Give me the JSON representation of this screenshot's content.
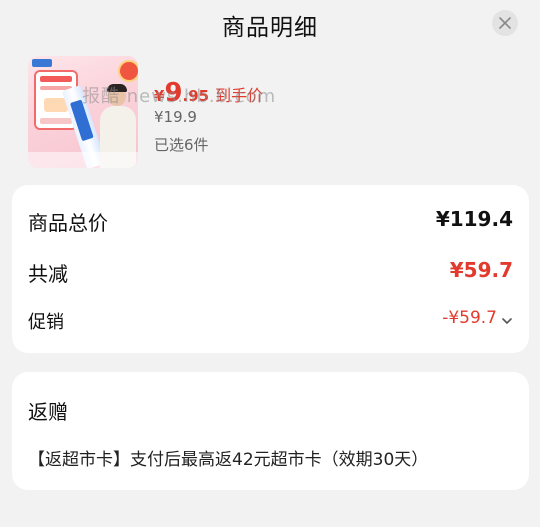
{
  "header": {
    "title": "商品明细",
    "close_icon": "close-icon"
  },
  "product": {
    "image_icon": "toothpaste-product-image",
    "price_currency": "¥",
    "price_integer": "9",
    "price_decimal": ".95",
    "price_tag": "到手价",
    "original_price": "¥19.9",
    "selected_count": "已选6件"
  },
  "summary": {
    "total_label": "商品总价",
    "total_value": "¥119.4",
    "reduce_label": "共减",
    "reduce_value": "¥59.7",
    "promo_label": "促销",
    "promo_value": "-¥59.7",
    "promo_chevron": "chevron-down-icon"
  },
  "gift": {
    "title": "返赠",
    "text": "【返超市卡】支付后最高返42元超市卡（效期30天）"
  },
  "watermark": {
    "text": "报酷 news.hb.b.com"
  },
  "colors": {
    "accent_red": "#e23b2e",
    "background": "#f2f2f2",
    "card": "#ffffff"
  }
}
